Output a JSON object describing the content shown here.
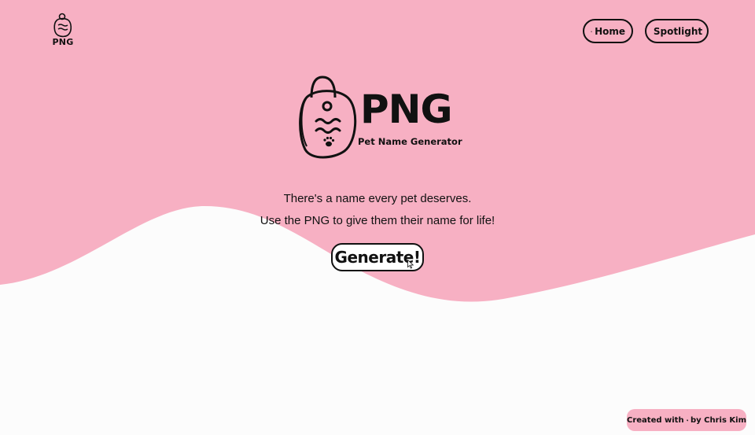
{
  "colors": {
    "hero_pink": "#f7b0c3",
    "background": "#fcfcfc",
    "ink": "#111111"
  },
  "nav": {
    "logo_text": "PNG",
    "home_label": "Home",
    "spotlight_label": "Spotlight",
    "home_icon": "house-icon",
    "spotlight_icon": "bunny-icon"
  },
  "hero": {
    "title": "PNG",
    "subtitle": "Pet Name Generator",
    "tagline_1": "There's a name every pet deserves.",
    "tagline_2": "Use the PNG to give them their name for life!",
    "generate_label": "Generate!"
  },
  "footer": {
    "prefix": "Created with",
    "heart_icon": "heart-icon",
    "suffix": "by Chris Kim"
  }
}
